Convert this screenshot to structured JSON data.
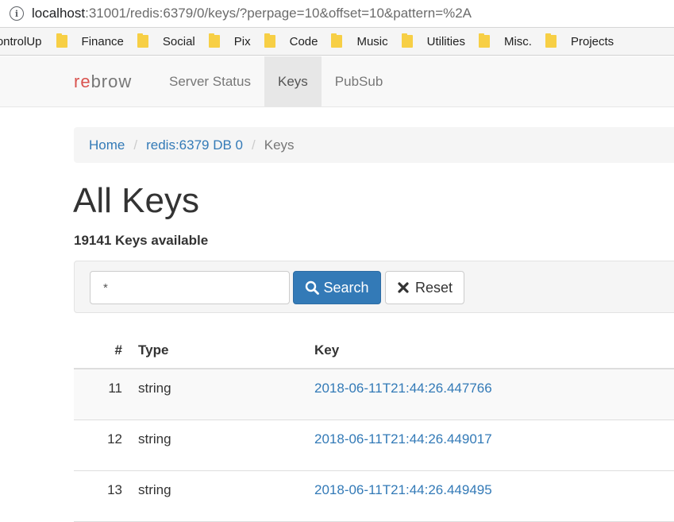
{
  "browser": {
    "url_host": "localhost",
    "url_path": ":31001/redis:6379/0/keys/?perpage=10&offset=10&pattern=%2A",
    "bookmarks": [
      "ControlUp",
      "Finance",
      "Social",
      "Pix",
      "Code",
      "Music",
      "Utilities",
      "Misc.",
      "Projects"
    ]
  },
  "navbar": {
    "brand_prefix": "re",
    "brand_suffix": "brow",
    "items": [
      {
        "label": "Server Status",
        "active": false
      },
      {
        "label": "Keys",
        "active": true
      },
      {
        "label": "PubSub",
        "active": false
      }
    ]
  },
  "breadcrumb": {
    "home": "Home",
    "db": "redis:6379 DB 0",
    "current": "Keys",
    "separator": "/"
  },
  "page": {
    "title": "All Keys",
    "keys_available": "19141 Keys available"
  },
  "search": {
    "value": "*",
    "search_label": "Search",
    "reset_label": "Reset",
    "search_color": "#337ab7"
  },
  "table": {
    "headers": {
      "num": "#",
      "type": "Type",
      "key": "Key"
    },
    "rows": [
      {
        "num": "11",
        "type": "string",
        "key": "2018-06-11T21:44:26.447766"
      },
      {
        "num": "12",
        "type": "string",
        "key": "2018-06-11T21:44:26.449017"
      },
      {
        "num": "13",
        "type": "string",
        "key": "2018-06-11T21:44:26.449495"
      }
    ]
  }
}
